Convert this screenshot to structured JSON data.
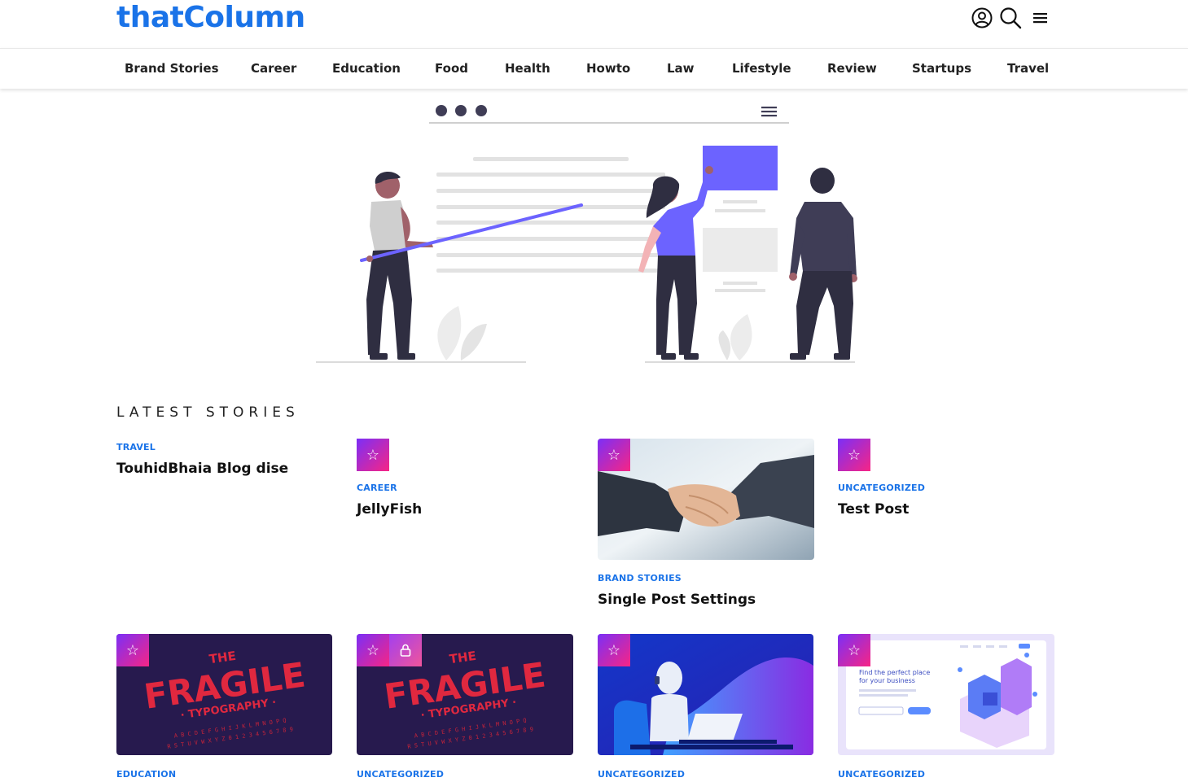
{
  "header": {
    "logo": "thatColumn",
    "icons": [
      "user-circle-icon",
      "search-icon",
      "menu-icon"
    ]
  },
  "nav": {
    "items": [
      "Brand Stories",
      "Career",
      "Education",
      "Food",
      "Health",
      "Howto",
      "Law",
      "Lifestyle",
      "Review",
      "Startups",
      "Travel"
    ]
  },
  "section": {
    "title": "LATEST STORIES"
  },
  "stories": [
    {
      "category": "TRAVEL",
      "title": "TouhidBhaia Blog dise"
    },
    {
      "category": "CAREER",
      "title": "JellyFish",
      "badge": "star-icon"
    },
    {
      "category": "BRAND STORIES",
      "title": "Single Post Settings",
      "badge": "star-icon",
      "image": "handshake-image"
    },
    {
      "category": "UNCATEGORIZED",
      "title": "Test Post",
      "badge": "star-icon"
    },
    {
      "category": "EDUCATION",
      "badge": "star-icon",
      "image": "fragile-typography-image"
    },
    {
      "category": "UNCATEGORIZED",
      "badge": "star-icon",
      "badge2": "lock-icon",
      "image": "fragile-typography-image"
    },
    {
      "category": "UNCATEGORIZED",
      "badge": "star-icon",
      "image": "robot-laptop-image"
    },
    {
      "category": "UNCATEGORIZED",
      "badge": "star-icon",
      "image": "business-landing-image"
    }
  ],
  "images": {
    "fragile": {
      "line1": "THE",
      "line2": "FRAGILE",
      "line3": "· TYPOGRAPHY ·",
      "alpha1": "A B C D E F G H I J K L M N O P Q",
      "alpha2": "R S T U V W X Y Z 0 1 2 3 4 5 6 7 8 9"
    },
    "landing": {
      "headline1": "Find the perfect place",
      "headline2": "for your business"
    }
  },
  "colors": {
    "brand": "#1a73e8",
    "accent": "#6c63ff",
    "badge_start": "#7b2ff7",
    "badge_end": "#f72585",
    "fragile_bg": "#271a4e",
    "fragile_text": "#e0283f"
  }
}
